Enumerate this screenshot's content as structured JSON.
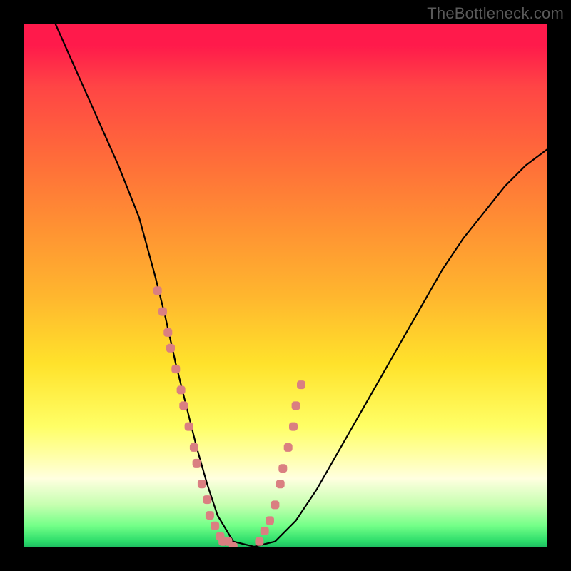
{
  "watermark": "TheBottleneck.com",
  "colors": {
    "frame": "#000000",
    "gradient_top": "#ff1a4b",
    "gradient_bottom": "#1fbf62",
    "curve": "#000000",
    "dot": "#da7f81"
  },
  "chart_data": {
    "type": "line",
    "title": "",
    "xlabel": "",
    "ylabel": "",
    "xlim": [
      0,
      100
    ],
    "ylim": [
      0,
      100
    ],
    "series": [
      {
        "name": "bottleneck-curve",
        "x": [
          6,
          10,
          14,
          18,
          22,
          25,
          27,
          29,
          31,
          33,
          35,
          37,
          40,
          44,
          48,
          52,
          56,
          60,
          64,
          68,
          72,
          76,
          80,
          84,
          88,
          92,
          96,
          100
        ],
        "y": [
          100,
          91,
          82,
          73,
          63,
          52,
          44,
          35,
          27,
          19,
          12,
          6,
          1,
          0,
          1,
          5,
          11,
          18,
          25,
          32,
          39,
          46,
          53,
          59,
          64,
          69,
          73,
          76
        ]
      },
      {
        "name": "highlight-dots",
        "x": [
          25.5,
          26.5,
          27.5,
          28.0,
          29.0,
          30.0,
          30.5,
          31.5,
          32.5,
          33.0,
          34.0,
          35.0,
          35.5,
          36.5,
          37.5,
          38.0,
          39.0,
          40.0,
          45.0,
          46.0,
          47.0,
          48.0,
          49.0,
          49.5,
          50.5,
          51.5,
          52.0,
          53.0
        ],
        "y": [
          49,
          45,
          41,
          38,
          34,
          30,
          27,
          23,
          19,
          16,
          12,
          9,
          6,
          4,
          2,
          1,
          1,
          0,
          1,
          3,
          5,
          8,
          12,
          15,
          19,
          23,
          27,
          31
        ]
      }
    ]
  }
}
